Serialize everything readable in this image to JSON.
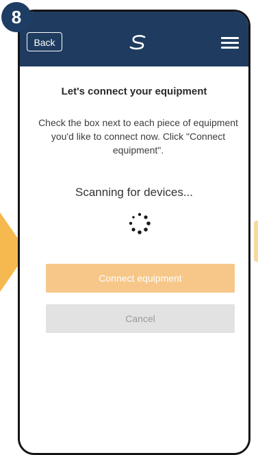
{
  "step": {
    "number": "8"
  },
  "header": {
    "back_label": "Back",
    "logo_icon": "salus-logo-icon",
    "menu_icon": "hamburger-menu-icon",
    "background_color": "#1f3c60"
  },
  "main": {
    "title": "Let's connect your equipment",
    "instruction_lines": [
      "Check the box next to each piece of equipment",
      "you'd like to connect now. Click \"Connect",
      "equipment\"."
    ],
    "scan_status": "Scanning for devices...",
    "spinner_icon": "loading-spinner-icon"
  },
  "buttons": {
    "connect_label": "Connect equipment",
    "connect_color": "#f6c789",
    "cancel_label": "Cancel",
    "cancel_color": "#e2e2e2"
  },
  "decor": {
    "arrow_color": "#f6b94f"
  }
}
